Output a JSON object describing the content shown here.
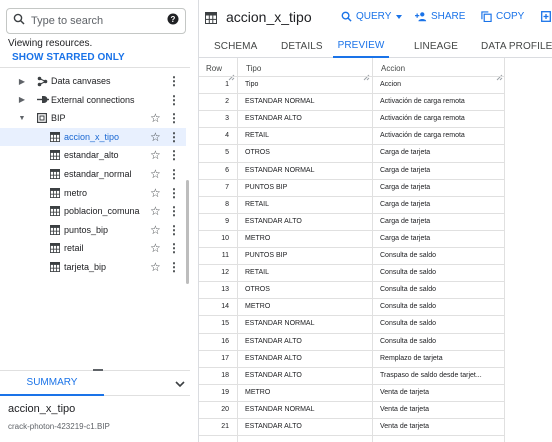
{
  "explorer": {
    "search_placeholder": "Type to search",
    "viewing_text": "Viewing resources.",
    "show_starred_label": "SHOW STARRED ONLY",
    "tree": [
      {
        "label": "Data canvases",
        "kind": "canvas",
        "level": 1,
        "expand": "collapsed",
        "selected": false
      },
      {
        "label": "External connections",
        "kind": "connection",
        "level": 1,
        "expand": "collapsed",
        "selected": false
      },
      {
        "label": "BIP",
        "kind": "dataset",
        "level": 1,
        "expand": "expanded",
        "selected": false
      },
      {
        "label": "accion_x_tipo",
        "kind": "table",
        "level": 2,
        "expand": "none",
        "selected": true
      },
      {
        "label": "estandar_alto",
        "kind": "table",
        "level": 2,
        "expand": "none",
        "selected": false
      },
      {
        "label": "estandar_normal",
        "kind": "table",
        "level": 2,
        "expand": "none",
        "selected": false
      },
      {
        "label": "metro",
        "kind": "table",
        "level": 2,
        "expand": "none",
        "selected": false
      },
      {
        "label": "poblacion_comuna",
        "kind": "table",
        "level": 2,
        "expand": "none",
        "selected": false
      },
      {
        "label": "puntos_bip",
        "kind": "table",
        "level": 2,
        "expand": "none",
        "selected": false
      },
      {
        "label": "retail",
        "kind": "table",
        "level": 2,
        "expand": "none",
        "selected": false
      },
      {
        "label": "tarjeta_bip",
        "kind": "table",
        "level": 2,
        "expand": "none",
        "selected": false
      }
    ],
    "summary_tab_label": "SUMMARY",
    "summary_title": "accion_x_tipo",
    "summary_subtitle": "crack-photon-423219-c1.BIP"
  },
  "table_view": {
    "title": "accion_x_tipo",
    "toolbar": {
      "query_label": "QUERY",
      "share_label": "SHARE",
      "copy_label": "COPY"
    },
    "tabs": [
      "SCHEMA",
      "DETAILS",
      "PREVIEW",
      "LINEAGE",
      "DATA PROFILE"
    ],
    "active_tab": "PREVIEW",
    "columns": [
      "Row",
      "Tipo",
      "Accion"
    ],
    "rows": [
      [
        "1",
        "Tipo",
        "Accion"
      ],
      [
        "2",
        "ESTANDAR NORMAL",
        "Activación de carga remota"
      ],
      [
        "3",
        "ESTANDAR ALTO",
        "Activación de carga remota"
      ],
      [
        "4",
        "RETAIL",
        "Activación de carga remota"
      ],
      [
        "5",
        "OTROS",
        "Carga de tarjeta"
      ],
      [
        "6",
        "ESTANDAR NORMAL",
        "Carga de tarjeta"
      ],
      [
        "7",
        "PUNTOS BIP",
        "Carga de tarjeta"
      ],
      [
        "8",
        "RETAIL",
        "Carga de tarjeta"
      ],
      [
        "9",
        "ESTANDAR ALTO",
        "Carga de tarjeta"
      ],
      [
        "10",
        "METRO",
        "Carga de tarjeta"
      ],
      [
        "11",
        "PUNTOS BIP",
        "Consulta de saldo"
      ],
      [
        "12",
        "RETAIL",
        "Consulta de saldo"
      ],
      [
        "13",
        "OTROS",
        "Consulta de saldo"
      ],
      [
        "14",
        "METRO",
        "Consulta de saldo"
      ],
      [
        "15",
        "ESTANDAR NORMAL",
        "Consulta de saldo"
      ],
      [
        "16",
        "ESTANDAR ALTO",
        "Consulta de saldo"
      ],
      [
        "17",
        "ESTANDAR ALTO",
        "Remplazo de tarjeta"
      ],
      [
        "18",
        "ESTANDAR ALTO",
        "Traspaso de saldo desde tarjet..."
      ],
      [
        "19",
        "METRO",
        "Venta de tarjeta"
      ],
      [
        "20",
        "ESTANDAR NORMAL",
        "Venta de tarjeta"
      ],
      [
        "21",
        "ESTANDAR ALTO",
        "Venta de tarjeta"
      ]
    ]
  },
  "colors": {
    "accent": "#1a73e8",
    "selected_bg": "#e8f0fe",
    "grid_line": "#e0e0e0"
  }
}
